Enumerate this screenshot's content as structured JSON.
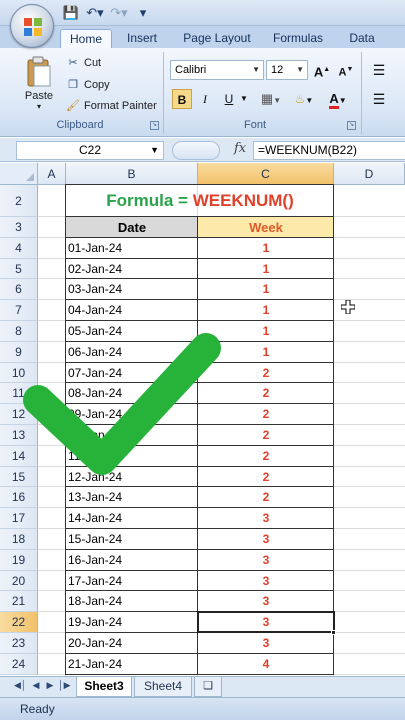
{
  "ribbon": {
    "tabs": [
      "Home",
      "Insert",
      "Page Layout",
      "Formulas",
      "Data"
    ],
    "clipboard": {
      "paste_label": "Paste",
      "cut_label": "Cut",
      "copy_label": "Copy",
      "format_painter_label": "Format Painter",
      "group_label": "Clipboard"
    },
    "font": {
      "font_name": "Calibri",
      "font_size": "12",
      "bold": "B",
      "italic": "I",
      "underline": "U",
      "group_label": "Font"
    }
  },
  "formula_bar": {
    "cell_ref": "C22",
    "fx": "fx",
    "formula": "=WEEKNUM(B22)"
  },
  "columns": [
    "A",
    "B",
    "C",
    "D"
  ],
  "rows": [
    "2",
    "3",
    "4",
    "5",
    "6",
    "7",
    "8",
    "9",
    "10",
    "11",
    "12",
    "13",
    "14",
    "15",
    "16",
    "17",
    "18",
    "19",
    "20",
    "21",
    "22",
    "23",
    "24"
  ],
  "sheet": {
    "title_prefix": "Formula = ",
    "title_func": "WEEKNUM()",
    "header_date": "Date",
    "header_week": "Week",
    "data": [
      {
        "date": "01-Jan-24",
        "week": "1"
      },
      {
        "date": "02-Jan-24",
        "week": "1"
      },
      {
        "date": "03-Jan-24",
        "week": "1"
      },
      {
        "date": "04-Jan-24",
        "week": "1"
      },
      {
        "date": "05-Jan-24",
        "week": "1"
      },
      {
        "date": "06-Jan-24",
        "week": "1"
      },
      {
        "date": "07-Jan-24",
        "week": "2"
      },
      {
        "date": "08-Jan-24",
        "week": "2"
      },
      {
        "date": "09-Jan-24",
        "week": "2"
      },
      {
        "date": "10-Jan-24",
        "week": "2"
      },
      {
        "date": "11-Jan-24",
        "week": "2"
      },
      {
        "date": "12-Jan-24",
        "week": "2"
      },
      {
        "date": "13-Jan-24",
        "week": "2"
      },
      {
        "date": "14-Jan-24",
        "week": "3"
      },
      {
        "date": "15-Jan-24",
        "week": "3"
      },
      {
        "date": "16-Jan-24",
        "week": "3"
      },
      {
        "date": "17-Jan-24",
        "week": "3"
      },
      {
        "date": "18-Jan-24",
        "week": "3"
      },
      {
        "date": "19-Jan-24",
        "week": "3"
      },
      {
        "date": "20-Jan-24",
        "week": "3"
      },
      {
        "date": "21-Jan-24",
        "week": "4"
      }
    ]
  },
  "sheet_tabs": [
    "Sheet3",
    "Sheet4"
  ],
  "status": {
    "text": "Ready"
  },
  "colors": {
    "title_green": "#2aa34a",
    "title_orange": "#e0412a",
    "check_green": "#27b33a"
  }
}
